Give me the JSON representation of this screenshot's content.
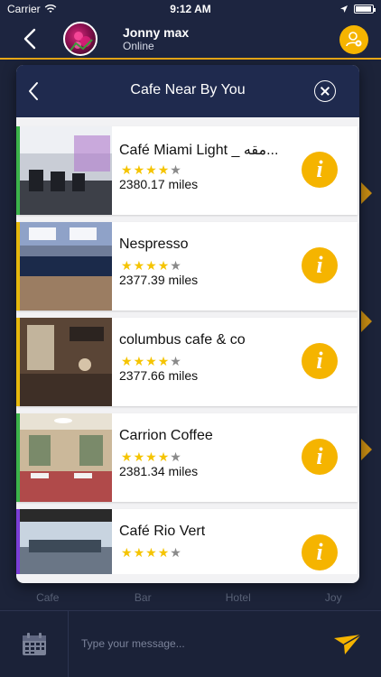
{
  "status_bar": {
    "carrier": "Carrier",
    "time": "9:12 AM"
  },
  "header": {
    "user_name": "Jonny max",
    "user_status": "Online"
  },
  "modal": {
    "title": "Cafe Near By You",
    "items": [
      {
        "name": "Café Miami Light _ مقه...",
        "rating": 4,
        "distance": "2380.17 miles",
        "accent": "#3bb34a"
      },
      {
        "name": "Nespresso",
        "rating": 4,
        "distance": "2377.39 miles",
        "accent": "#e5b80c"
      },
      {
        "name": "columbus cafe & co",
        "rating": 4,
        "distance": "2377.66 miles",
        "accent": "#e5b80c"
      },
      {
        "name": "Carrion Coffee",
        "rating": 4,
        "distance": "2381.34 miles",
        "accent": "#3bb34a"
      },
      {
        "name": "Café Rio Vert",
        "rating": 4,
        "distance": "",
        "accent": "#7a3ed6"
      }
    ]
  },
  "categories": [
    "Cafe",
    "Bar",
    "Hotel",
    "Joy"
  ],
  "composer": {
    "placeholder": "Type your message..."
  },
  "icons": {
    "back": "chevron-left-icon",
    "close": "close-circle-icon",
    "info": "info-icon",
    "calendar": "calendar-icon",
    "send": "send-icon",
    "profile": "user-add-icon"
  },
  "colors": {
    "accent": "#f5b400",
    "header_bg": "#1d2540",
    "modal_header": "#1f2a4e"
  }
}
